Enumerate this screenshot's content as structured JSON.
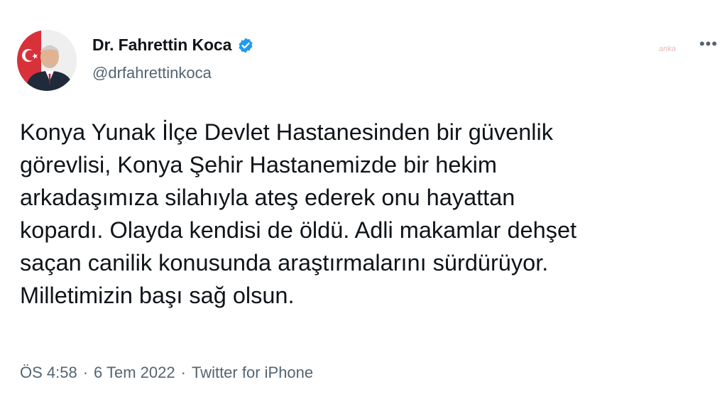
{
  "author": {
    "display_name": "Dr. Fahrettin Koca",
    "handle": "@drfahrettinkoca",
    "verified_icon": "verified-badge-icon",
    "verified_color": "#1d9bf0"
  },
  "watermark": "anka",
  "more_label": "•••",
  "tweet": {
    "lines": [
      "Konya Yunak İlçe Devlet Hastanesinden bir güvenlik",
      "görevlisi, Konya Şehir Hastanemizde bir hekim",
      "arkadaşımıza silahıyla ateş ederek onu hayattan",
      "kopardı. Olayda kendisi de öldü. Adli makamlar dehşet",
      "saçan canilik konusunda araştırmalarını sürdürüyor.",
      "Milletimizin başı sağ olsun."
    ]
  },
  "meta": {
    "time": "ÖS 4:58",
    "sep1": "·",
    "date": "6 Tem 2022",
    "sep2": "·",
    "source": "Twitter for iPhone"
  },
  "colors": {
    "text": "#0f1419",
    "secondary": "#536471",
    "background": "#ffffff"
  }
}
